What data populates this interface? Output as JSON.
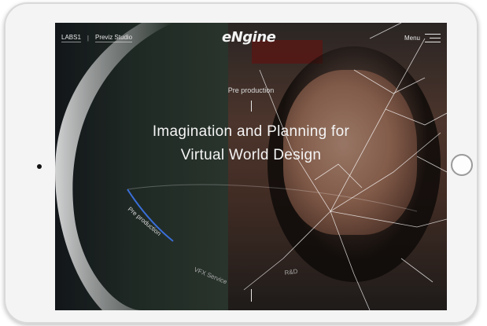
{
  "header": {
    "nav_left": [
      "LABS1",
      "Previz Studio"
    ],
    "logo_text": "eNgine",
    "menu_label": "Menu"
  },
  "hero": {
    "eyebrow": "Pre production",
    "headline_line1": "Imagination and Planning for",
    "headline_line2": "Virtual World Design"
  },
  "services_wheel": {
    "items": [
      {
        "label": "Pre production",
        "active": true
      },
      {
        "label": "VFX Service",
        "active": false
      },
      {
        "label": "R&D",
        "active": false
      }
    ],
    "accent_color": "#3a6fd8"
  }
}
